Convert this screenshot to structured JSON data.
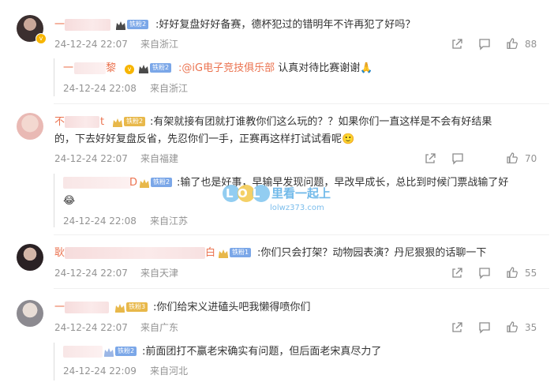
{
  "comments": [
    {
      "text": ":好好复盘好好备赛，德杯犯过的错明年不许再犯了好吗？",
      "fan_badge": "铁粉2",
      "time": "24-12-24 22:07",
      "location": "来自浙江",
      "likes": "88",
      "reply": {
        "name_prefix": "一",
        "name_suffix": "黎",
        "fan_badge": "铁粉2",
        "mention": ":@iG电子竞技俱乐部",
        "text": " 认真对待比赛谢谢🙏",
        "time": "24-12-24 22:08",
        "location": "来自浙江"
      }
    },
    {
      "name_prefix": "不",
      "name_suffix": "t",
      "text_line1": ":有架就接有团就打谁教你们这么玩的？？如果你们一直这样是不会有好结果",
      "text_line2": "的，下去好好复盘反省，先忍你们一手，正赛再这样打试试看呢🙂",
      "fan_badge": "铁粉2",
      "time": "24-12-24 22:07",
      "location": "来自福建",
      "likes": "70",
      "reply": {
        "name_suffix": "D",
        "fan_badge": "铁粉2",
        "text_line1": ":输了也是好事，早输早发现问题，早改早成长，总比到时候门票战输了好",
        "text_line2": "😂",
        "time": "24-12-24 22:08",
        "location": "来自江苏"
      }
    },
    {
      "name_prefix": "耿",
      "name_suffix": "白",
      "fan_badge": "铁粉1",
      "text": ":你们只会打架？动物园表演？丹尼狠狠的话聊一下",
      "time": "24-12-24 22:07",
      "location": "来自天津",
      "likes": "55"
    },
    {
      "name_prefix": "一",
      "fan_badge": "铁粉3",
      "text": ":你们给宋义进磕头吧我懒得喷你们",
      "time": "24-12-24 22:07",
      "location": "来自广东",
      "likes": "35",
      "reply": {
        "fan_badge": "铁粉2",
        "text": ":前面团打不赢老宋确实有问题，但后面老宋真尽力了",
        "time": "24-12-24 22:09",
        "location": "来自河北"
      }
    }
  ],
  "watermark": {
    "logo_text": "LOL",
    "site_name": "里看一起上",
    "url": "lolwz373.com"
  },
  "icons": [
    "share-icon",
    "comment-icon",
    "like-icon"
  ],
  "colors": {
    "link": "#eb7350",
    "meta": "#939393",
    "fan_blue": "#7ba7e8",
    "fan_gold": "#e8b84a"
  }
}
